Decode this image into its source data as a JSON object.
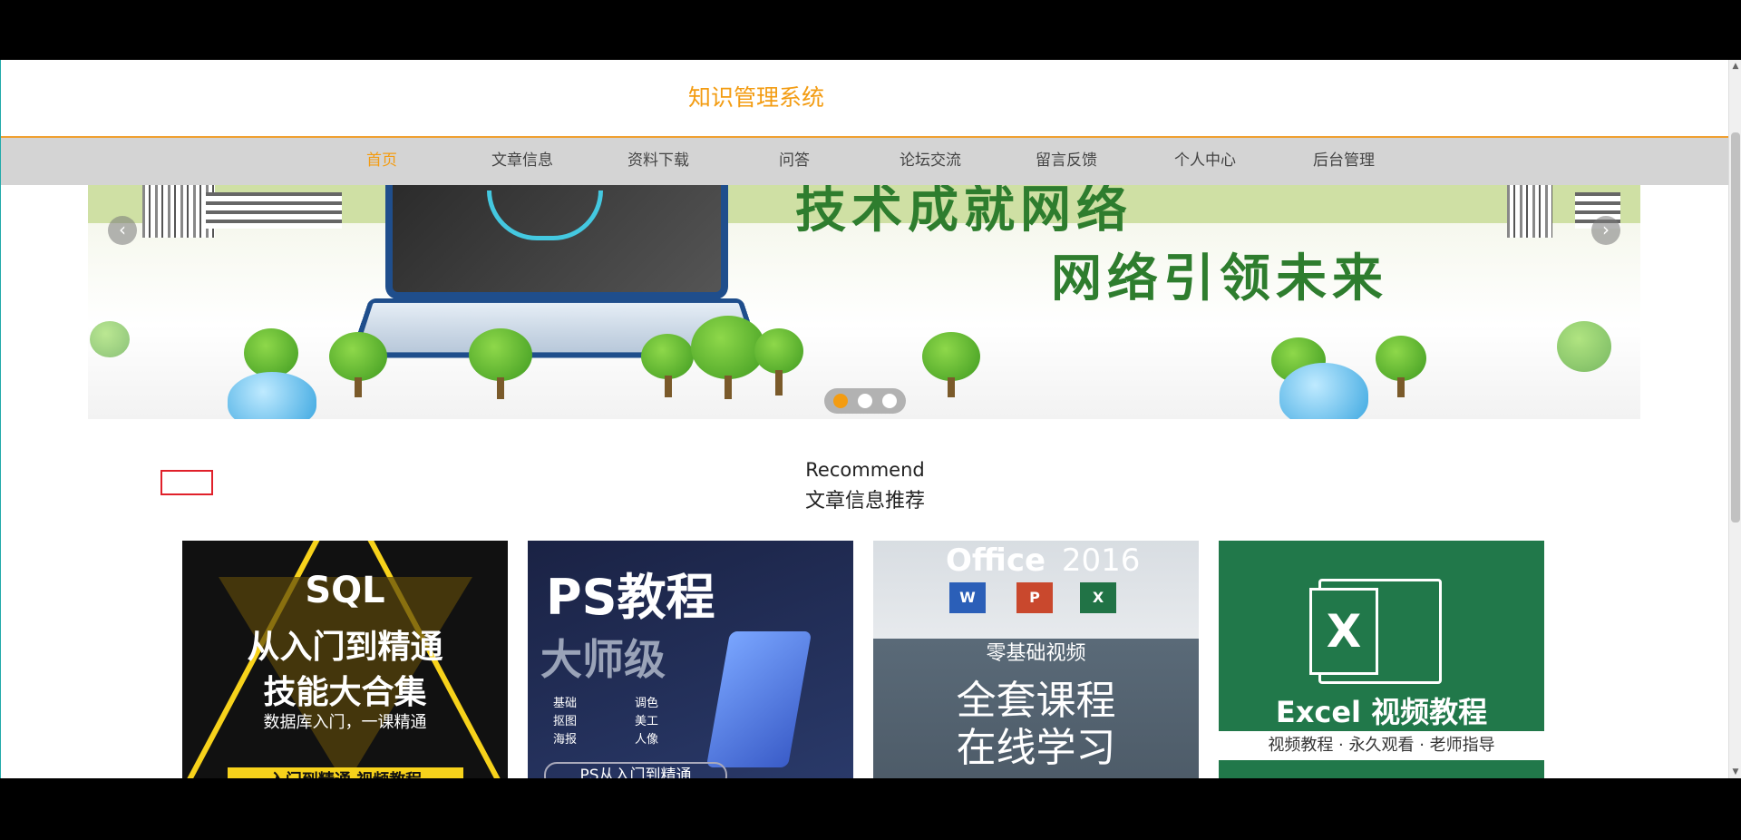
{
  "site": {
    "title": "知识管理系统"
  },
  "nav": {
    "items": [
      {
        "label": "首页",
        "active": true
      },
      {
        "label": "文章信息"
      },
      {
        "label": "资料下载"
      },
      {
        "label": "问答"
      },
      {
        "label": "论坛交流"
      },
      {
        "label": "留言反馈"
      },
      {
        "label": "个人中心"
      },
      {
        "label": "后台管理"
      }
    ]
  },
  "carousel": {
    "headline_top": "技术成就网络",
    "headline_bottom": "网络引领未来",
    "prev_icon": "‹",
    "next_icon": "›",
    "slide_count": 3,
    "active_slide": 1
  },
  "recommend": {
    "heading_en": "Recommend",
    "heading_cn": "文章信息推荐",
    "search_value": ""
  },
  "cards": [
    {
      "title_line1": "SQL",
      "title_line2": "从入门到精通",
      "title_line3": "技能大合集",
      "subtitle": "数据库入门，一课精通",
      "footer": "入门到精通 视频教程"
    },
    {
      "title": "PS教程",
      "subtitle": "大师级",
      "features": [
        "基础",
        "调色",
        "抠图",
        "美工",
        "海报",
        "人像"
      ],
      "footer": "PS从入门到精通"
    },
    {
      "brand": "Office",
      "year": "2016",
      "apps": [
        "W",
        "P",
        "X"
      ],
      "tagline": "零基础视频",
      "title_line1": "全套课程",
      "title_line2": "在线学习"
    },
    {
      "logo": "X",
      "title": "Excel 视频教程",
      "subtitle": "视频教程 · 永久观看 · 老师指导"
    }
  ],
  "colors": {
    "accent": "#f39c12",
    "nav_bg": "#d4d4d4",
    "banner_green": "#2e7d2e",
    "excel_green": "#21784a",
    "search_border": "#e0202a"
  }
}
